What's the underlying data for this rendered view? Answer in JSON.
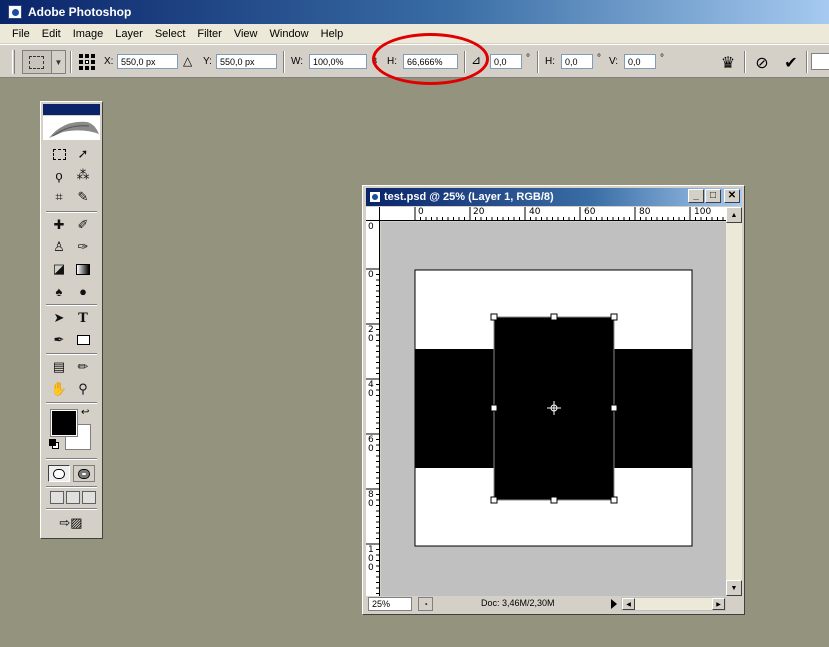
{
  "app": {
    "title": "Adobe Photoshop"
  },
  "menu": [
    "File",
    "Edit",
    "Image",
    "Layer",
    "Select",
    "Filter",
    "View",
    "Window",
    "Help"
  ],
  "options": {
    "x_label": "X:",
    "x_value": "550,0 px",
    "y_label": "Y:",
    "y_value": "550,0 px",
    "w_label": "W:",
    "w_value": "100,0%",
    "h_label": "H:",
    "h_value": "66,666%",
    "rotate_value": "0,0",
    "hskew_label": "H:",
    "hskew_value": "0,0",
    "vskew_label": "V:",
    "vskew_value": "0,0",
    "degree_symbol": "°",
    "highlight_color": "#e00000"
  },
  "document": {
    "title": "test.psd @ 25% (Layer 1, RGB/8)",
    "zoom": "25%",
    "doc_info": "Doc: 3,46M/2,30M",
    "ruler_top": [
      "0",
      "20",
      "40",
      "60",
      "80",
      "100"
    ],
    "ruler_left": [
      "0",
      "0",
      "2 0",
      "4 0",
      "6 0",
      "8 0",
      "1 0 0"
    ]
  }
}
